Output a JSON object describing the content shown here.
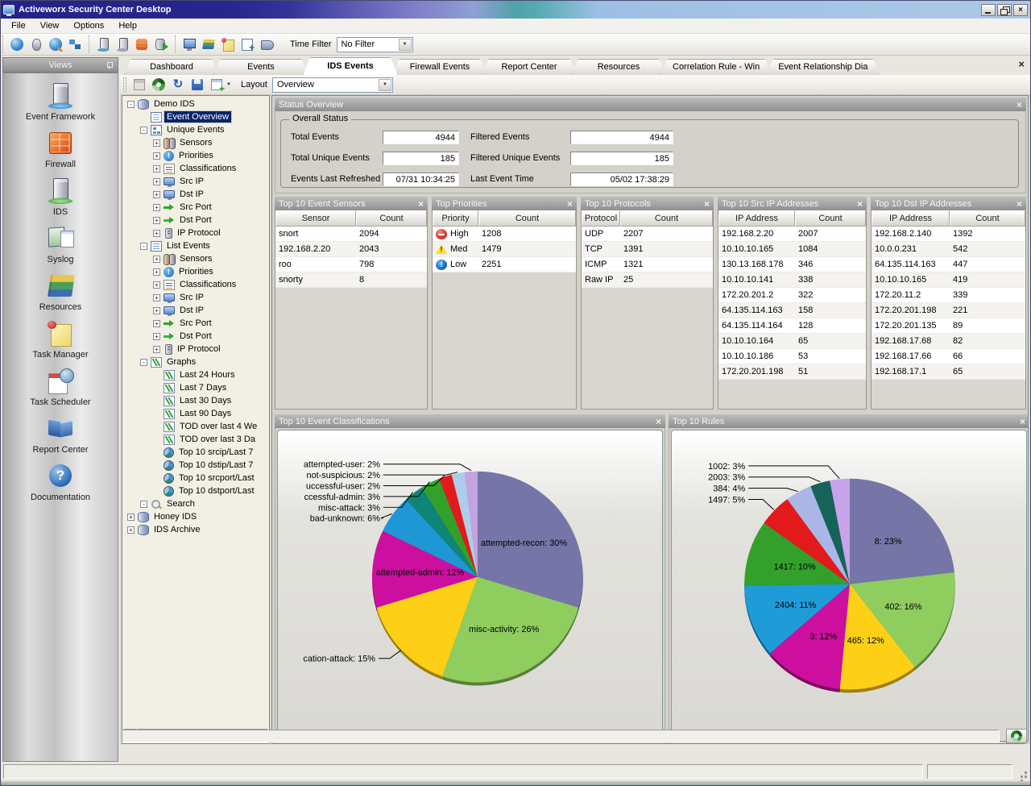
{
  "window": {
    "title": "Activeworx Security Center Desktop"
  },
  "menu": {
    "items": [
      "File",
      "View",
      "Options",
      "Help"
    ]
  },
  "toolbar": {
    "groups": [
      [
        "globe",
        "mouse",
        "search",
        "network"
      ],
      [
        "server-a",
        "server-b",
        "firewall-db",
        "db-export"
      ],
      [
        "monitor",
        "books",
        "note",
        "add-image",
        "help-book"
      ]
    ],
    "time_filter_label": "Time Filter",
    "time_filter_value": "No Filter"
  },
  "sidebar": {
    "title": "Views",
    "items": [
      {
        "label": "Event Framework",
        "icon": "event-framework"
      },
      {
        "label": "Firewall",
        "icon": "firewall"
      },
      {
        "label": "IDS",
        "icon": "ids"
      },
      {
        "label": "Syslog",
        "icon": "syslog"
      },
      {
        "label": "Resources",
        "icon": "resources"
      },
      {
        "label": "Task Manager",
        "icon": "task-manager"
      },
      {
        "label": "Task Scheduler",
        "icon": "task-scheduler"
      },
      {
        "label": "Report Center",
        "icon": "report-center"
      },
      {
        "label": "Documentation",
        "icon": "documentation"
      }
    ]
  },
  "tabs": {
    "items": [
      "Dashboard",
      "Events",
      "IDS Events",
      "Firewall Events",
      "Report Center",
      "Resources",
      "Correlation Rule - Win",
      "Event Relationship Dia"
    ],
    "active": "IDS Events"
  },
  "layout_toolbar": {
    "icons": [
      "grid",
      "go",
      "refresh",
      "save",
      "add-window"
    ],
    "label": "Layout",
    "value": "Overview"
  },
  "tree": {
    "items": [
      {
        "label": "Demo IDS",
        "depth": 0,
        "expand": "minus",
        "icon": "db"
      },
      {
        "label": "Event Overview",
        "depth": 1,
        "expand": null,
        "icon": "doc",
        "selected": true
      },
      {
        "label": "Unique Events",
        "depth": 1,
        "expand": "minus",
        "icon": "tree"
      },
      {
        "label": "Sensors",
        "depth": 2,
        "expand": "plus",
        "icon": "sensors"
      },
      {
        "label": "Priorities",
        "depth": 2,
        "expand": "plus",
        "icon": "alert"
      },
      {
        "label": "Classifications",
        "depth": 2,
        "expand": "plus",
        "icon": "class"
      },
      {
        "label": "Src IP",
        "depth": 2,
        "expand": "plus",
        "icon": "monitor"
      },
      {
        "label": "Dst IP",
        "depth": 2,
        "expand": "plus",
        "icon": "monitor"
      },
      {
        "label": "Src Port",
        "depth": 2,
        "expand": "plus",
        "icon": "arrow"
      },
      {
        "label": "Dst Port",
        "depth": 2,
        "expand": "plus",
        "icon": "arrow2"
      },
      {
        "label": "IP Protocol",
        "depth": 2,
        "expand": "plus",
        "icon": "server"
      },
      {
        "label": "List Events",
        "depth": 1,
        "expand": "minus",
        "icon": "list"
      },
      {
        "label": "Sensors",
        "depth": 2,
        "expand": "plus",
        "icon": "sensors"
      },
      {
        "label": "Priorities",
        "depth": 2,
        "expand": "plus",
        "icon": "alert"
      },
      {
        "label": "Classifications",
        "depth": 2,
        "expand": "plus",
        "icon": "class"
      },
      {
        "label": "Src IP",
        "depth": 2,
        "expand": "plus",
        "icon": "monitor"
      },
      {
        "label": "Dst IP",
        "depth": 2,
        "expand": "plus",
        "icon": "monitor"
      },
      {
        "label": "Src Port",
        "depth": 2,
        "expand": "plus",
        "icon": "arrow"
      },
      {
        "label": "Dst Port",
        "depth": 2,
        "expand": "plus",
        "icon": "arrow2"
      },
      {
        "label": "IP Protocol",
        "depth": 2,
        "expand": "plus",
        "icon": "server"
      },
      {
        "label": "Graphs",
        "depth": 1,
        "expand": "minus",
        "icon": "graph"
      },
      {
        "label": "Last 24 Hours",
        "depth": 2,
        "expand": null,
        "icon": "graph"
      },
      {
        "label": "Last 7 Days",
        "depth": 2,
        "expand": null,
        "icon": "graph"
      },
      {
        "label": "Last 30 Days",
        "depth": 2,
        "expand": null,
        "icon": "graph"
      },
      {
        "label": "Last 90 Days",
        "depth": 2,
        "expand": null,
        "icon": "graph"
      },
      {
        "label": "TOD over last 4 We",
        "depth": 2,
        "expand": null,
        "icon": "graph"
      },
      {
        "label": "TOD over last 3 Da",
        "depth": 2,
        "expand": null,
        "icon": "graph"
      },
      {
        "label": "Top 10 srcip/Last 7",
        "depth": 2,
        "expand": null,
        "icon": "pie"
      },
      {
        "label": "Top 10 dstip/Last 7",
        "depth": 2,
        "expand": null,
        "icon": "pie"
      },
      {
        "label": "Top 10 srcport/Last",
        "depth": 2,
        "expand": null,
        "icon": "pie"
      },
      {
        "label": "Top 10 dstport/Last",
        "depth": 2,
        "expand": null,
        "icon": "pie"
      },
      {
        "label": "Search",
        "depth": 1,
        "expand": "minus",
        "icon": "search"
      },
      {
        "label": "Honey IDS",
        "depth": 0,
        "expand": "plus",
        "icon": "db"
      },
      {
        "label": "IDS Archive",
        "depth": 0,
        "expand": "plus",
        "icon": "db"
      }
    ]
  },
  "status_overview": {
    "title": "Status Overview",
    "group_title": "Overall Status",
    "col1": [
      {
        "label": "Total Events",
        "value": "4944"
      },
      {
        "label": "Total Unique Events",
        "value": "185"
      },
      {
        "label": "Events Last Refreshed",
        "value": "07/31 10:34:25"
      }
    ],
    "col2": [
      {
        "label": "Filtered Events",
        "value": "4944"
      },
      {
        "label": "Filtered Unique Events",
        "value": "185"
      },
      {
        "label": "Last Event Time",
        "value": "05/02 17:38:29"
      }
    ]
  },
  "panels": [
    {
      "title": "Top 10 Event Sensors",
      "columns": [
        "Sensor",
        "Count"
      ],
      "rows": [
        {
          "name": "snort",
          "count": "2094"
        },
        {
          "name": "192.168.2.20",
          "count": "2043"
        },
        {
          "name": "roo",
          "count": "798"
        },
        {
          "name": "snorty",
          "count": "8"
        }
      ]
    },
    {
      "title": "Top Priorities",
      "columns": [
        "Priority",
        "Count"
      ],
      "rows": [
        {
          "name": "High",
          "count": "1208",
          "icon": "high"
        },
        {
          "name": "Med",
          "count": "1479",
          "icon": "med"
        },
        {
          "name": "Low",
          "count": "2251",
          "icon": "low"
        }
      ]
    },
    {
      "title": "Top 10 Protocols",
      "columns": [
        "Protocol",
        "Count"
      ],
      "rows": [
        {
          "name": "UDP",
          "count": "2207"
        },
        {
          "name": "TCP",
          "count": "1391"
        },
        {
          "name": "ICMP",
          "count": "1321"
        },
        {
          "name": "Raw IP",
          "count": "25"
        }
      ]
    },
    {
      "title": "Top 10 Src IP Addresses",
      "columns": [
        "IP Address",
        "Count"
      ],
      "rows": [
        {
          "name": "192.168.2.20",
          "count": "2007"
        },
        {
          "name": "10.10.10.165",
          "count": "1084"
        },
        {
          "name": "130.13.168.178",
          "count": "346"
        },
        {
          "name": "10.10.10.141",
          "count": "338"
        },
        {
          "name": "172.20.201.2",
          "count": "322"
        },
        {
          "name": "64.135.114.163",
          "count": "158"
        },
        {
          "name": "64.135.114.164",
          "count": "128"
        },
        {
          "name": "10.10.10.164",
          "count": "65"
        },
        {
          "name": "10.10.10.186",
          "count": "53"
        },
        {
          "name": "172.20.201.198",
          "count": "51"
        }
      ]
    },
    {
      "title": "Top 10 Dst IP Addresses",
      "columns": [
        "IP Address",
        "Count"
      ],
      "rows": [
        {
          "name": "192.168.2.140",
          "count": "1392"
        },
        {
          "name": "10.0.0.231",
          "count": "542"
        },
        {
          "name": "64.135.114.163",
          "count": "447"
        },
        {
          "name": "10.10.10.165",
          "count": "419"
        },
        {
          "name": "172.20.11.2",
          "count": "339"
        },
        {
          "name": "172.20.201.198",
          "count": "221"
        },
        {
          "name": "172.20.201.135",
          "count": "89"
        },
        {
          "name": "192.168.17.68",
          "count": "82"
        },
        {
          "name": "192.168.17.66",
          "count": "66"
        },
        {
          "name": "192.168.17.1",
          "count": "65"
        }
      ]
    }
  ],
  "chart_data": [
    {
      "type": "pie",
      "title": "Top 10 Event Classifications",
      "legend_position": "none",
      "slices": [
        {
          "label": "attempted-recon",
          "pct": 30,
          "color": "#7575a8",
          "label_mode": "inside"
        },
        {
          "label": "misc-activity",
          "pct": 26,
          "color": "#8fcd5e",
          "label_mode": "inside"
        },
        {
          "label": "cation-attack",
          "pct": 15,
          "color": "#fdd017",
          "label_mode": "left"
        },
        {
          "label": "attempted-admin",
          "pct": 12,
          "color": "#cc0f9e",
          "label_mode": "inside"
        },
        {
          "label": "bad-unknown",
          "pct": 6,
          "color": "#1f97d4",
          "label_mode": "stack"
        },
        {
          "label": "misc-attack",
          "pct": 3,
          "color": "#0f8578",
          "label_mode": "stack"
        },
        {
          "label": "ccessful-admin",
          "pct": 3,
          "color": "#33a02c",
          "label_mode": "stack"
        },
        {
          "label": "uccessful-user",
          "pct": 2,
          "color": "#e31a1c",
          "label_mode": "stack"
        },
        {
          "label": "not-suspicious",
          "pct": 2,
          "color": "#aecde8",
          "label_mode": "stack"
        },
        {
          "label": "attempted-user",
          "pct": 2,
          "color": "#c5a3e0",
          "label_mode": "stack"
        }
      ]
    },
    {
      "type": "pie",
      "title": "Top 10 Rules",
      "legend_position": "none",
      "slices": [
        {
          "label": "8",
          "pct": 23,
          "color": "#7575a8",
          "label_mode": "inside"
        },
        {
          "label": "402",
          "pct": 16,
          "color": "#8fcd5e",
          "label_mode": "inside"
        },
        {
          "label": "465",
          "pct": 12,
          "color": "#fdd017",
          "label_mode": "inside"
        },
        {
          "label": "3",
          "pct": 12,
          "color": "#cc0f9e",
          "label_mode": "inside"
        },
        {
          "label": "2404",
          "pct": 11,
          "color": "#1f9cd8",
          "label_mode": "inside"
        },
        {
          "label": "1417",
          "pct": 10,
          "color": "#33a02c",
          "label_mode": "inside"
        },
        {
          "label": "1497",
          "pct": 5,
          "color": "#e31a1c",
          "label_mode": "stack"
        },
        {
          "label": "384",
          "pct": 4,
          "color": "#aab7e6",
          "label_mode": "stack"
        },
        {
          "label": "2003",
          "pct": 3,
          "color": "#16635a",
          "label_mode": "stack"
        },
        {
          "label": "1002",
          "pct": 3,
          "color": "#c9a3ec",
          "label_mode": "stack"
        }
      ]
    }
  ],
  "ui": {
    "close_glyph": "×",
    "dropdown_glyph": "▼",
    "scroll_left_glyph": "◄",
    "scroll_right_glyph": "►"
  }
}
